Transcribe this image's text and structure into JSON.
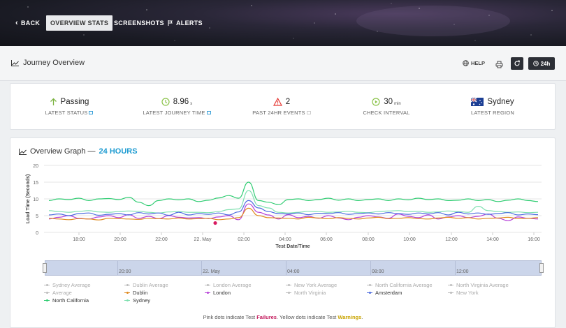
{
  "nav": {
    "back": "BACK",
    "overview": "OVERVIEW STATS",
    "screenshots": "SCREENSHOTS",
    "alerts": "ALERTS"
  },
  "header": {
    "title": "Journey Overview",
    "help": "HELP",
    "range": "24h"
  },
  "stats": [
    {
      "value": "Passing",
      "unit": "",
      "label": "LATEST STATUS",
      "icon": "up-arrow-icon"
    },
    {
      "value": "8.96",
      "unit": "s",
      "label": "LATEST JOURNEY TIME",
      "icon": "clock-icon"
    },
    {
      "value": "2",
      "unit": "",
      "label": "PAST 24HR EVENTS",
      "icon": "warning-icon"
    },
    {
      "value": "30",
      "unit": "min",
      "label": "CHECK INTERVAL",
      "icon": "play-icon"
    },
    {
      "value": "Sydney",
      "unit": "",
      "label": "LATEST REGION",
      "icon": "australia-flag-icon"
    }
  ],
  "graph": {
    "title": "Overview Graph —",
    "range": "24 HOURS"
  },
  "chart_data": {
    "type": "line",
    "ylabel": "Load Time (Seconds)",
    "xlabel": "Test Date/Time",
    "ylim": [
      0,
      20
    ],
    "yticks": [
      "0",
      "5",
      "10",
      "15",
      "20"
    ],
    "xticks": [
      "18:00",
      "20:00",
      "22:00",
      "22. May",
      "02:00",
      "04:00",
      "06:00",
      "08:00",
      "10:00",
      "12:00",
      "14:00",
      "16:00"
    ],
    "series": [
      {
        "name": "North California",
        "color": "#2ecc71",
        "values": [
          9.5,
          10,
          9.8,
          10.2,
          9.5,
          10,
          10.1,
          9.8,
          10.5,
          9,
          8,
          9.5,
          10,
          9.7,
          10,
          9.2,
          9.6,
          10.3,
          11,
          10.2,
          15,
          9.5,
          9,
          8.3,
          9.8,
          10,
          9.5,
          9.8,
          10.2,
          9.6,
          10,
          9.5,
          9.8,
          10,
          9.5,
          10,
          9.7,
          10.2,
          9.8,
          10,
          9.5,
          9.6,
          10,
          9.5,
          9.8,
          9.2,
          9.6,
          10,
          9.5,
          9.2
        ]
      },
      {
        "name": "Sydney",
        "color": "#7fe0b0",
        "values": [
          6.5,
          6.2,
          6,
          6.3,
          6.5,
          6.1,
          6,
          6.2,
          6.4,
          6.3,
          6,
          5.8,
          6.1,
          6.2,
          6,
          6,
          5.9,
          6.2,
          6.8,
          7,
          12.5,
          8,
          7.3,
          6,
          5.8,
          6,
          6.3,
          6.2,
          6,
          6.1,
          6.3,
          6,
          5.9,
          6.2,
          6.4,
          6.5,
          6.2,
          6.3,
          6,
          6.1,
          6.4,
          6.2,
          6,
          7.8,
          6.5,
          6.2,
          6,
          6.1,
          5.9,
          6
        ]
      },
      {
        "name": "London",
        "color": "#b640d8",
        "values": [
          4,
          4.5,
          5,
          4.2,
          4,
          4.6,
          5,
          4.4,
          5.3,
          4.2,
          4.8,
          4.1,
          5,
          4.5,
          4.3,
          4.4,
          4.1,
          4.6,
          5,
          3.8,
          8.5,
          6,
          5.2,
          4,
          5.3,
          4.4,
          4.8,
          4.2,
          5,
          4.3,
          3.8,
          4.5,
          5,
          4.6,
          4.2,
          5.5,
          4.8,
          4.4,
          5.2,
          4,
          4.6,
          5,
          4.4,
          4.8,
          5.5,
          4.2,
          3.5,
          4.6,
          4.2,
          4
        ]
      },
      {
        "name": "Dublin",
        "color": "#e08a1e",
        "values": [
          4.2,
          4,
          3.8,
          4.1,
          4,
          3.7,
          4.2,
          4.1,
          4,
          3.9,
          4.2,
          4.1,
          4,
          4.3,
          4,
          4.1,
          4.2,
          3.8,
          4,
          4.4,
          7.2,
          5,
          4.4,
          4.3,
          4.2,
          4,
          4.5,
          4.3,
          4.1,
          4.4,
          4.2,
          4,
          4.3,
          4.5,
          4.1,
          4.2,
          4.4,
          4.1,
          4,
          4.3,
          4.5,
          4.2,
          4.4,
          4,
          4.2,
          4.3,
          4.5,
          4.1,
          4.2,
          4.4
        ]
      },
      {
        "name": "Amsterdam",
        "color": "#4d6be0",
        "values": [
          5.2,
          5.5,
          5,
          5.6,
          5.8,
          5.1,
          5.4,
          5.6,
          5.2,
          5.9,
          5.5,
          5.8,
          5.1,
          6,
          5.2,
          5.6,
          5.4,
          5.8,
          5.2,
          6.1,
          9.5,
          7.3,
          6.2,
          5.6,
          5.5,
          5.8,
          5.3,
          5.7,
          5.6,
          5.9,
          5.4,
          5.6,
          5.8,
          5.5,
          5.9,
          5.6,
          5.4,
          5.8,
          5.5,
          5.9,
          5.2,
          6,
          5.5,
          5.8,
          5.4,
          5.6,
          5.9,
          5.2,
          5.5,
          5.3
        ]
      }
    ],
    "failure_points": [
      {
        "x": "22. May",
        "y": 2.8
      }
    ],
    "legend": [
      {
        "name": "Sydney Average",
        "active": false,
        "color": "#bbbbbb"
      },
      {
        "name": "Dublin Average",
        "active": false,
        "color": "#bbbbbb"
      },
      {
        "name": "London Average",
        "active": false,
        "color": "#bbbbbb"
      },
      {
        "name": "New York Average",
        "active": false,
        "color": "#bbbbbb"
      },
      {
        "name": "North California Average",
        "active": false,
        "color": "#bbbbbb"
      },
      {
        "name": "North Virginia Average",
        "active": false,
        "color": "#bbbbbb"
      },
      {
        "name": "Average",
        "active": false,
        "color": "#bbbbbb"
      },
      {
        "name": "Dublin",
        "active": true,
        "color": "#e08a1e"
      },
      {
        "name": "London",
        "active": true,
        "color": "#b640d8"
      },
      {
        "name": "North Virginia",
        "active": false,
        "color": "#bbbbbb"
      },
      {
        "name": "Amsterdam",
        "active": true,
        "color": "#4d6be0"
      },
      {
        "name": "New York",
        "active": false,
        "color": "#bbbbbb"
      },
      {
        "name": "North California",
        "active": true,
        "color": "#2ecc71"
      },
      {
        "name": "Sydney",
        "active": true,
        "color": "#7fe0b0"
      }
    ]
  },
  "navigator": {
    "labels": [
      "20:00",
      "22. May",
      "04:00",
      "08:00",
      "12:00"
    ]
  },
  "note": {
    "prefix": "Pink dots indicate Test ",
    "failures": "Failures",
    "mid": ". Yellow dots indicate Test ",
    "warnings": "Warnings",
    "suffix": "."
  }
}
